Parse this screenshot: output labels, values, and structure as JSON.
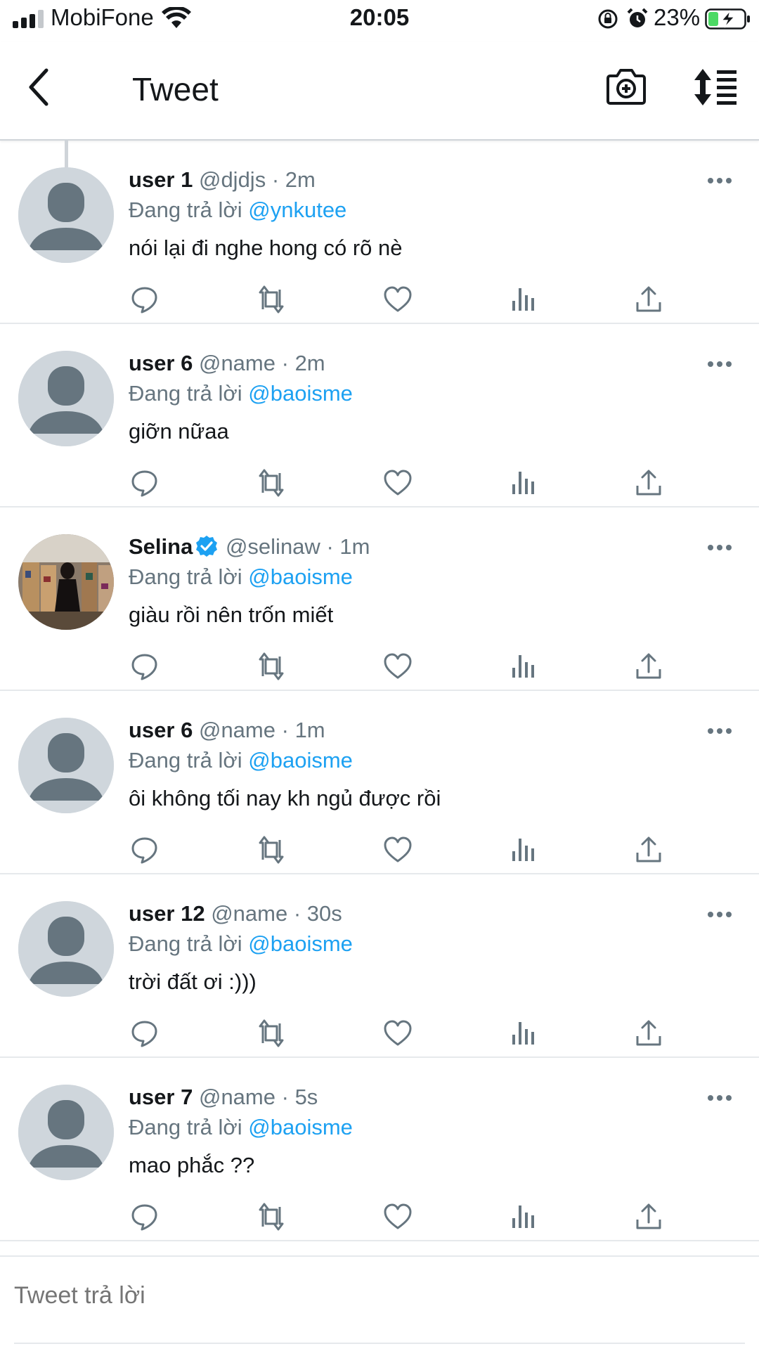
{
  "status_bar": {
    "carrier": "MobiFone",
    "time": "20:05",
    "battery": "23%"
  },
  "nav": {
    "title": "Tweet",
    "back_icon": "chevron-left-icon",
    "camera_icon": "camera-add-icon",
    "sort_icon": "sort-icon"
  },
  "colors": {
    "link": "#1da1f2",
    "secondary_text": "#66757f",
    "avatar_bg": "#cfd6dc",
    "avatar_fg": "#66757f",
    "battery_fill": "#4cd964"
  },
  "tweets": [
    {
      "name": "user 1",
      "handle": "@djdjs",
      "dot": "·",
      "time": "2m",
      "reply_prefix": "Đang trả lời",
      "reply_to": "@ynkutee",
      "text": "nói lại đi nghe hong có rõ nè",
      "verified": false
    },
    {
      "name": "user 6",
      "handle": "@name",
      "dot": "·",
      "time": "2m",
      "reply_prefix": "Đang trả lời",
      "reply_to": "@baoisme",
      "text": "giỡn nữaa",
      "verified": false
    },
    {
      "name": "Selina",
      "handle": "@selinaw",
      "dot": "·",
      "time": "1m",
      "reply_prefix": "Đang trả lời",
      "reply_to": "@baoisme",
      "text": "giàu rồi nên trốn miết",
      "verified": true
    },
    {
      "name": "user 6",
      "handle": "@name",
      "dot": "·",
      "time": "1m",
      "reply_prefix": "Đang trả lời",
      "reply_to": "@baoisme",
      "text": "ôi không tối nay kh ngủ được rồi",
      "verified": false
    },
    {
      "name": "user 12",
      "handle": "@name",
      "dot": "·",
      "time": "30s",
      "reply_prefix": "Đang trả lời",
      "reply_to": "@baoisme",
      "text": "trời đất ơi :)))",
      "verified": false
    },
    {
      "name": "user 7",
      "handle": "@name",
      "dot": "·",
      "time": "5s",
      "reply_prefix": "Đang trả lời",
      "reply_to": "@baoisme",
      "text": "mao phắc ??",
      "verified": false
    }
  ],
  "composer": {
    "placeholder": "Tweet trả lời"
  }
}
